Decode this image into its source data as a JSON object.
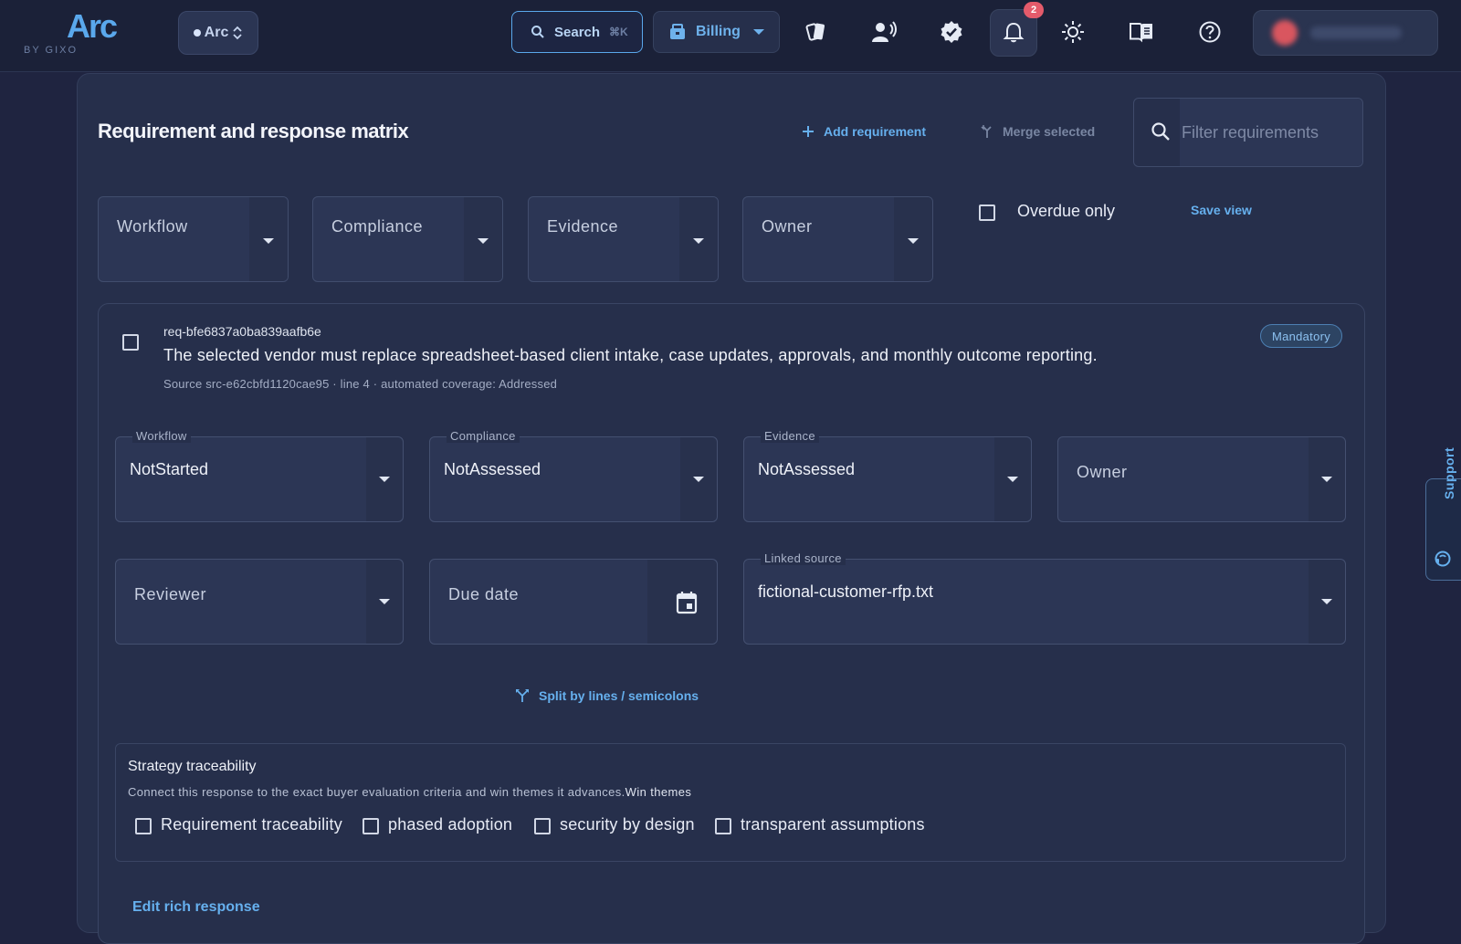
{
  "header": {
    "logo": "Arc",
    "logo_sub": "BY GIXO",
    "workspace": "Arc",
    "search_label": "Search",
    "search_shortcut": "⌘K",
    "billing_label": "Billing",
    "notification_count": "2"
  },
  "page": {
    "title": "Requirement and response matrix",
    "add_requirement": "Add requirement",
    "merge_selected": "Merge selected",
    "filter_placeholder": "Filter requirements"
  },
  "filters": {
    "workflow": "Workflow",
    "compliance": "Compliance",
    "evidence": "Evidence",
    "owner": "Owner",
    "overdue_only": "Overdue only",
    "overdue_checked": false,
    "save_view": "Save view"
  },
  "requirement": {
    "id": "req-bfe6837a0ba839aafb6e",
    "text": "The selected vendor must replace spreadsheet-based client intake, case updates, approvals, and monthly outcome reporting.",
    "meta": "Source src-e62cbfd1120cae95 · line 4 · automated coverage: Addressed",
    "badge": "Mandatory",
    "fields": {
      "workflow_label": "Workflow",
      "workflow_value": "NotStarted",
      "compliance_label": "Compliance",
      "compliance_value": "NotAssessed",
      "evidence_label": "Evidence",
      "evidence_value": "NotAssessed",
      "owner_placeholder": "Owner",
      "reviewer_placeholder": "Reviewer",
      "due_date_placeholder": "Due date",
      "linked_source_label": "Linked source",
      "linked_source_value": "fictional-customer-rfp.txt"
    },
    "split_link": "Split by lines / semicolons",
    "strategy": {
      "title": "Strategy traceability",
      "description": "Connect this response to the exact buyer evaluation criteria and win themes it advances.",
      "win_themes_label": "Win themes",
      "themes": [
        "Requirement traceability",
        "phased adoption",
        "security by design",
        "transparent assumptions"
      ]
    },
    "edit_rich": "Edit rich response"
  },
  "support_tab": "Support",
  "colors": {
    "background": "#1f2440",
    "surface": "#262f4b",
    "accent": "#5aa8ec",
    "badge_red": "#e45b6b"
  }
}
